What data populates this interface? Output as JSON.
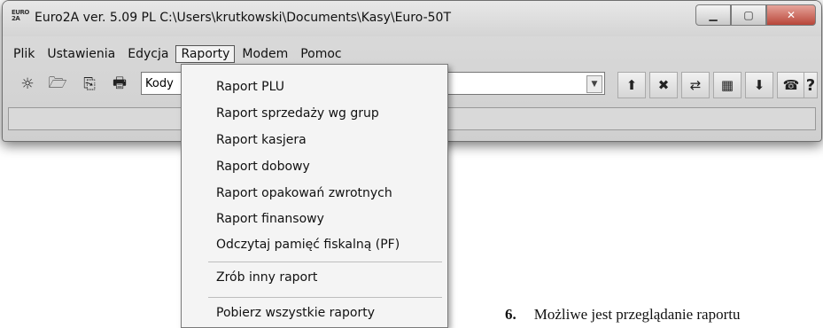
{
  "window": {
    "title": "Euro2A ver. 5.09 PL   C:\\Users\\krutkowski\\Documents\\Kasy\\Euro-50T",
    "app_icon_text": "EURO\n2A",
    "minimize_glyph": "▁",
    "maximize_glyph": "▢",
    "close_glyph": "✕"
  },
  "menubar": {
    "items": [
      {
        "label": "Plik"
      },
      {
        "label": "Ustawienia"
      },
      {
        "label": "Edycja"
      },
      {
        "label": "Raporty",
        "active": true
      },
      {
        "label": "Modem"
      },
      {
        "label": "Pomoc"
      }
    ]
  },
  "toolbar": {
    "combo_value": "Kody",
    "left_icons": [
      "new-icon",
      "open-icon",
      "copy-icon",
      "print-icon"
    ],
    "left_glyphs": [
      "☼",
      "🗁",
      "⎘",
      "🖶"
    ],
    "right_icons": [
      "send-icon",
      "delete-icon",
      "rep-plu-icon",
      "table-icon",
      "receive-icon",
      "phone-icon",
      "help-icon"
    ],
    "right_glyphs": [
      "⬆",
      "✖",
      "⇄",
      "▦",
      "⬇",
      "☎",
      "?"
    ]
  },
  "raporty_menu": {
    "items": [
      "Raport PLU",
      "Raport sprzedaży wg grup",
      "Raport kasjera",
      "Raport dobowy",
      "Raport opakowań zwrotnych",
      "Raport finansowy",
      "Odczytaj pamięć fiskalną (PF)",
      "Zrób inny raport",
      "Pobierz wszystkie raporty"
    ]
  },
  "paper_text": {
    "number": "6.",
    "text": "Możliwe jest przeglądanie raportu"
  }
}
